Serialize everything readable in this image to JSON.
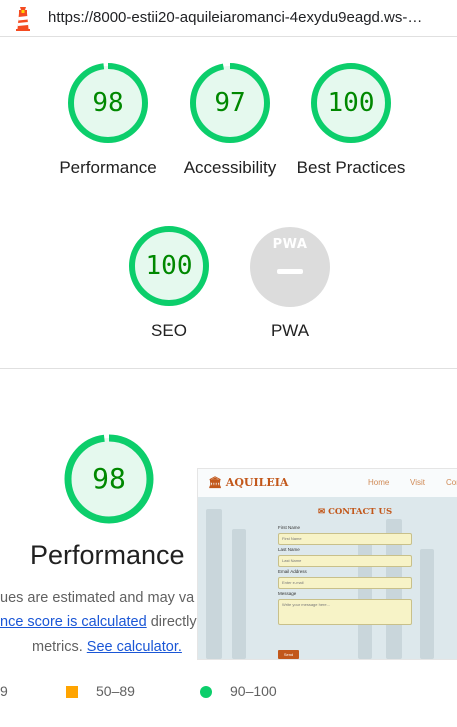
{
  "browser": {
    "url": "https://8000-estii20-aquileiaromanci-4exydu9eagd.ws-…",
    "icon": "lighthouse-icon"
  },
  "categories": [
    {
      "label": "Performance",
      "score": "98",
      "fraction": 0.98
    },
    {
      "label": "Accessibility",
      "score": "97",
      "fraction": 0.97
    },
    {
      "label": "Best Practices",
      "score": "100",
      "fraction": 1.0
    },
    {
      "label": "SEO",
      "score": "100",
      "fraction": 1.0
    },
    {
      "label": "PWA",
      "badge": "PWA"
    }
  ],
  "performance": {
    "score": "98",
    "fraction": 0.98,
    "title": "Performance",
    "note_line1": "ues are estimated and may va",
    "note_link": "nce score is calculated",
    "note_line2_rest": " directly",
    "note_line3": "metrics. ",
    "calculator_link": "See calculator."
  },
  "legend": {
    "low": "9",
    "mid": "50–89",
    "high": "90–100"
  },
  "thumbnail": {
    "brand": "AQUILEIA",
    "nav": [
      "Home",
      "Visit",
      "Con"
    ],
    "contact_title": "CONTACT US",
    "fields": [
      {
        "label": "First Name",
        "placeholder": "First Name"
      },
      {
        "label": "Last Name",
        "placeholder": "Last Name"
      },
      {
        "label": "Email Address",
        "placeholder": "Enter e-mail"
      },
      {
        "label": "Message",
        "placeholder": "Write your message here..."
      }
    ],
    "send": "Send"
  },
  "colors": {
    "pass": "#0cce6b",
    "pass_text": "#008800",
    "pass_fill": "#e5f9ee",
    "average": "#ffa400",
    "link": "#1a56d6",
    "pwa_gray": "#dcdcdc"
  }
}
